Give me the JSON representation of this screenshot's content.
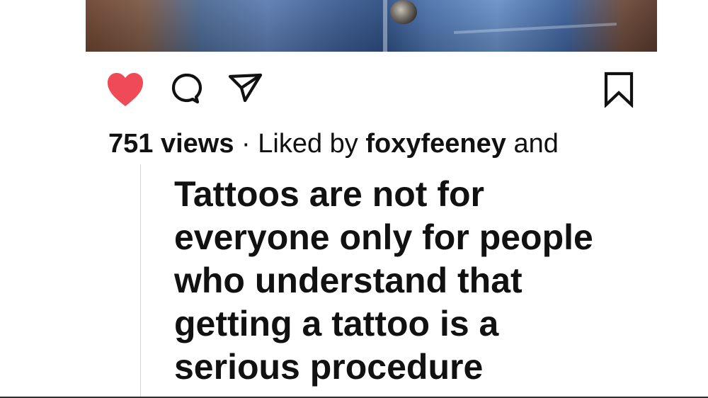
{
  "post": {
    "image_label": "post-image",
    "actions": {
      "like_icon": "heart-icon",
      "comment_icon": "comment-icon",
      "share_icon": "paper-plane-icon",
      "save_icon": "bookmark-icon"
    },
    "views_text": "751 views",
    "separator": "·",
    "liked_by_prefix": "Liked by",
    "liked_by_user": "foxyfeeney",
    "liked_by_suffix": "and",
    "quote_lines": [
      "Tattoos are not for",
      "everyone only for people",
      "who understand that",
      "getting a tattoo is a",
      "serious procedure"
    ]
  },
  "colors": {
    "like_red": "#ef4a57",
    "text_dark": "#111111",
    "border": "#d6d6d6",
    "background": "#ffffff"
  }
}
